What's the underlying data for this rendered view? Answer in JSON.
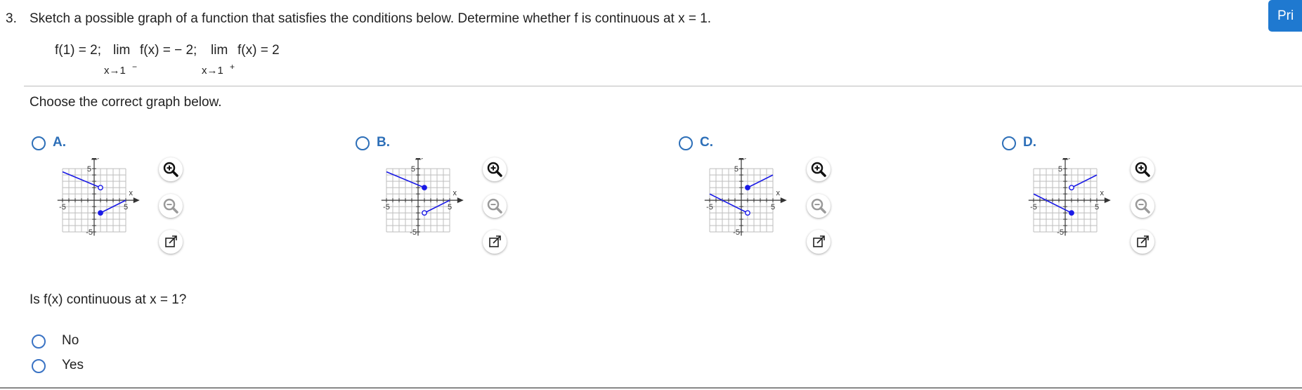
{
  "question": {
    "number": "3.",
    "text": "Sketch a possible graph of a function that satisfies the conditions below. Determine whether f is continuous at x = 1."
  },
  "conditions": {
    "f_value": "f(1) = 2;",
    "lim1_word": "lim",
    "lim1_expr": "f(x) = − 2;",
    "lim1_sub": "x→1",
    "lim1_sup": "−",
    "lim2_word": "lim",
    "lim2_expr": "f(x) = 2",
    "lim2_sub": "x→1",
    "lim2_sup": "+"
  },
  "print_button": "Pri",
  "instruction": "Choose the correct graph below.",
  "graph_labels": {
    "y": "y",
    "x": "x",
    "pos5": "5",
    "neg5": "-5"
  },
  "options": [
    {
      "letter": "A.",
      "left_segment": {
        "from": [
          -5,
          4.5
        ],
        "to": [
          1,
          2
        ],
        "end": "open"
      },
      "right_segment": {
        "from": [
          1,
          -2
        ],
        "to": [
          5,
          0
        ],
        "start": "closed"
      }
    },
    {
      "letter": "B.",
      "left_segment": {
        "from": [
          -5,
          4.5
        ],
        "to": [
          1,
          2
        ],
        "end": "closed"
      },
      "right_segment": {
        "from": [
          1,
          -2
        ],
        "to": [
          5,
          0
        ],
        "start": "open"
      }
    },
    {
      "letter": "C.",
      "left_segment": {
        "from": [
          -5,
          1
        ],
        "to": [
          1,
          -2
        ],
        "end": "open"
      },
      "right_segment": {
        "from": [
          1,
          2
        ],
        "to": [
          5,
          4
        ],
        "start": "closed"
      }
    },
    {
      "letter": "D.",
      "left_segment": {
        "from": [
          -5,
          1
        ],
        "to": [
          1,
          -2
        ],
        "end": "closed"
      },
      "right_segment": {
        "from": [
          1,
          2
        ],
        "to": [
          5,
          4
        ],
        "start": "open"
      }
    }
  ],
  "continuity_question": "Is f(x) continuous at x = 1?",
  "answers": [
    {
      "label": "No"
    },
    {
      "label": "Yes"
    }
  ],
  "colors": {
    "accent": "#2d6fb8",
    "graph_line": "#1a1ae6",
    "print_bg": "#1f79d0",
    "grid": "#bdbdbd"
  }
}
